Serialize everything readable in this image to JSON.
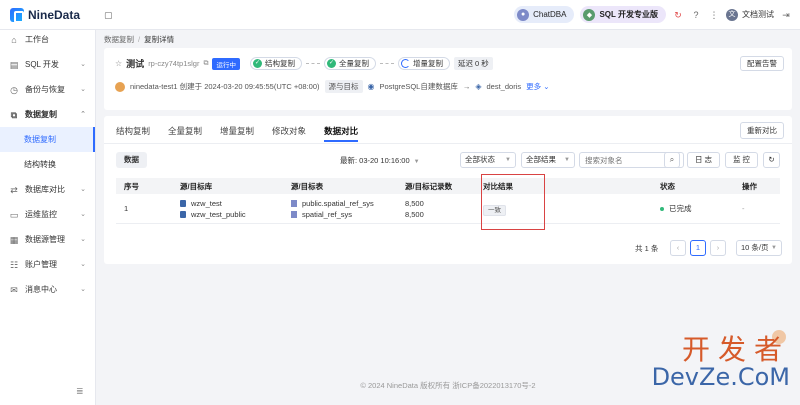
{
  "app": {
    "logo_text": "NineData"
  },
  "topbar": {
    "chatdba": "ChatDBA",
    "sql_pro": "SQL 开发专业版",
    "user": "文档测试"
  },
  "sidebar": {
    "items": [
      {
        "label": "工作台",
        "icon": "home-icon"
      },
      {
        "label": "SQL 开发",
        "icon": "sql-icon"
      },
      {
        "label": "备份与恢复",
        "icon": "backup-icon"
      },
      {
        "label": "数据复制",
        "icon": "copy-icon"
      },
      {
        "label": "数据库对比",
        "icon": "compare-icon"
      },
      {
        "label": "运维监控",
        "icon": "monitor-icon"
      },
      {
        "label": "数据源管理",
        "icon": "datasource-icon"
      },
      {
        "label": "账户管理",
        "icon": "account-icon"
      },
      {
        "label": "消息中心",
        "icon": "message-icon"
      }
    ],
    "sub_items": [
      {
        "label": "数据复制"
      },
      {
        "label": "结构转换"
      }
    ]
  },
  "breadcrumb": {
    "parent": "数据复制",
    "current": "复制详情"
  },
  "task": {
    "name": "测试",
    "id": "rp-czy74tp1slgr",
    "status": "运行中",
    "stage1": "结构复制",
    "stage2": "全量复制",
    "stage3": "增量复制",
    "latency": "延迟 0 秒",
    "alarm_button": "配置告警",
    "creator_line": "ninedata-test1 创建于 2024-03-20 09:45:55(UTC +08:00)",
    "src_label": "源与目标",
    "src": "PostgreSQL自建数据库",
    "dst": "dest_doris",
    "more": "更多"
  },
  "tabs": [
    "结构复制",
    "全量复制",
    "增量复制",
    "修改对象",
    "数据对比"
  ],
  "recompare_button": "重新对比",
  "toolbar": {
    "data_chip": "数据",
    "latest": "最新: 03-20 10:16:00",
    "status_select": "全部状态",
    "result_select": "全部结果",
    "search_placeholder": "搜索对象名",
    "log_button": "日 志",
    "monitor_button": "监 控"
  },
  "table": {
    "headers": [
      "序号",
      "源/目标库",
      "源/目标表",
      "源/目标记录数",
      "对比结果",
      "状态",
      "操作"
    ],
    "rows": [
      {
        "index": "1",
        "src_db": "wzw_test",
        "dst_db": "wzw_test_public",
        "src_table": "public.spatial_ref_sys",
        "dst_table": "spatial_ref_sys",
        "src_count": "8,500",
        "dst_count": "8,500",
        "result": "一致",
        "status": "已完成",
        "action": "-"
      }
    ]
  },
  "pager": {
    "total": "共 1 条",
    "page": "1",
    "size": "10 条/页"
  },
  "footer": "© 2024 NineData 版权所有   浙ICP备2022013170号-2",
  "watermark": {
    "line1": "开发者",
    "line2": "DevZe.CoM"
  },
  "colors": {
    "accent": "#2f6bff",
    "success": "#31b97a",
    "highlight_box": "#d94343"
  }
}
